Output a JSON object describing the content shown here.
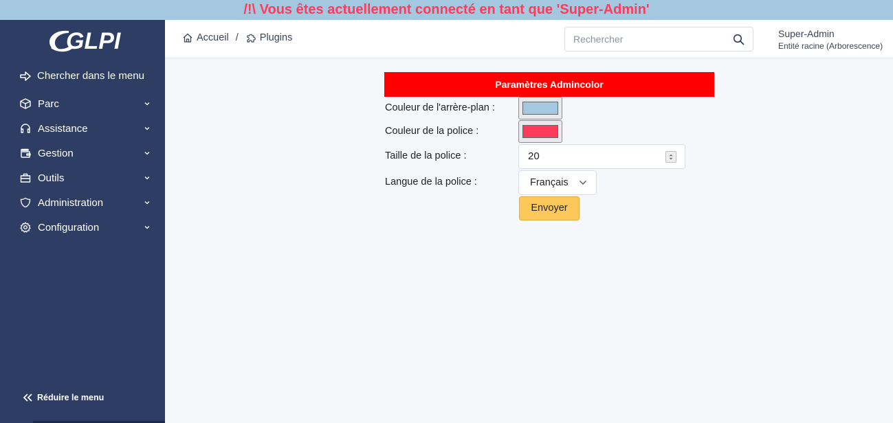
{
  "banner": "/!\\ Vous êtes actuellement connecté en tant que 'Super-Admin'",
  "logo": "GLPI",
  "sidebar": {
    "search_label": "Chercher dans le menu",
    "items": [
      {
        "label": "Parc",
        "icon": "box-icon"
      },
      {
        "label": "Assistance",
        "icon": "headset-icon"
      },
      {
        "label": "Gestion",
        "icon": "wallet-icon"
      },
      {
        "label": "Outils",
        "icon": "briefcase-icon"
      },
      {
        "label": "Administration",
        "icon": "shield-icon"
      },
      {
        "label": "Configuration",
        "icon": "gear-icon"
      }
    ],
    "reduce_label": "Réduire le menu"
  },
  "breadcrumb": {
    "home": "Accueil",
    "separator": "/",
    "current": "Plugins"
  },
  "search": {
    "placeholder": "Rechercher"
  },
  "user": {
    "name": "Super-Admin",
    "entity": "Entité racine (Arborescence)"
  },
  "form": {
    "title": "Paramètres Admincolor",
    "bg_color_label": "Couleur de l'arrère-plan :",
    "bg_color_value": "#a4c8e0",
    "font_color_label": "Couleur de la police :",
    "font_color_value": "#ff3b5c",
    "font_size_label": "Taille de la police :",
    "font_size_value": "20",
    "font_lang_label": "Langue de la police :",
    "font_lang_value": "Français",
    "submit_label": "Envoyer"
  },
  "colors": {
    "banner_bg": "#a4c8e0",
    "banner_text": "#ff3b5c",
    "sidebar_bg": "#2d3d63",
    "panel_header": "#ff0000",
    "submit_button": "#fcc85a"
  }
}
